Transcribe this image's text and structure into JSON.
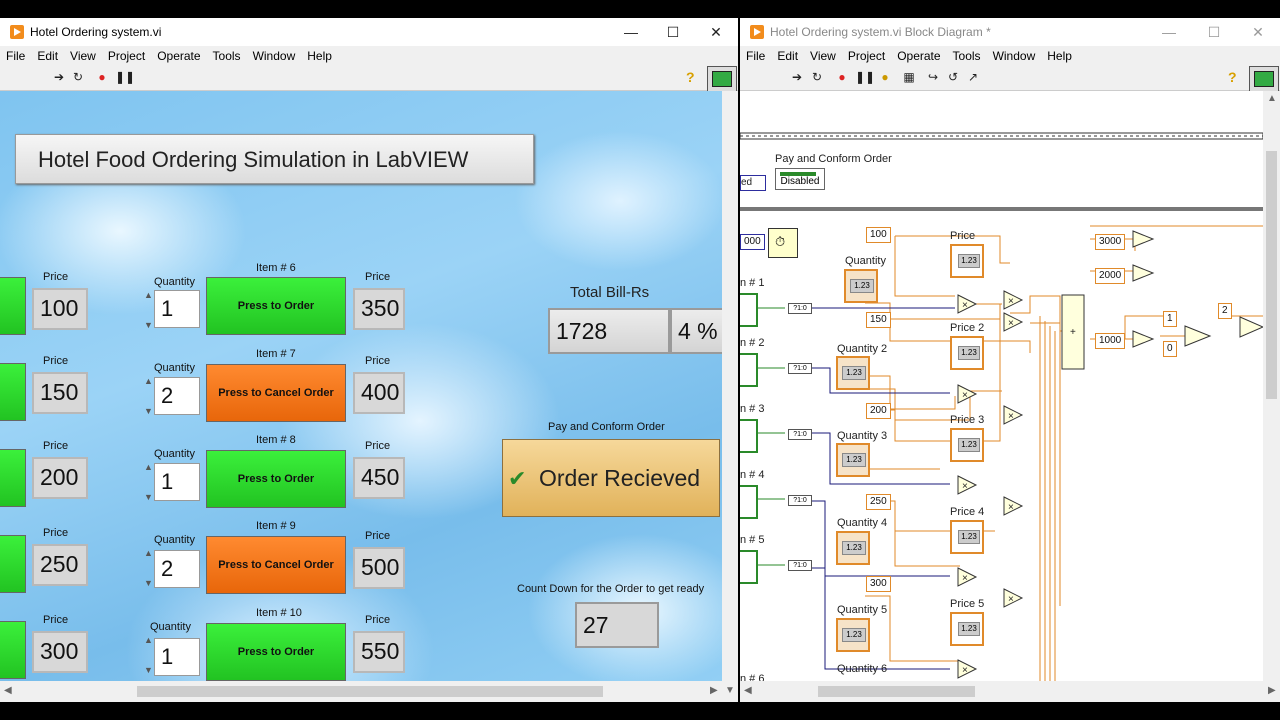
{
  "front": {
    "title": "Hotel Ordering system.vi",
    "menu": [
      "File",
      "Edit",
      "View",
      "Project",
      "Operate",
      "Tools",
      "Window",
      "Help"
    ],
    "banner": "Hotel Food Ordering Simulation in LabVIEW",
    "price_label": "Price",
    "quantity_label": "Quantity",
    "left_prices": [
      "100",
      "150",
      "200",
      "250",
      "300"
    ],
    "items": [
      {
        "label": "Item # 6",
        "qty": "1",
        "button": "Press to Order",
        "state": "order",
        "price": "350"
      },
      {
        "label": "Item # 7",
        "qty": "2",
        "button": "Press to Cancel Order",
        "state": "cancel",
        "price": "400"
      },
      {
        "label": "Item # 8",
        "qty": "1",
        "button": "Press to Order",
        "state": "order",
        "price": "450"
      },
      {
        "label": "Item # 9",
        "qty": "2",
        "button": "Press to Cancel Order",
        "state": "cancel",
        "price": "500"
      },
      {
        "label": "Item # 10",
        "qty": "1",
        "button": "Press to Order",
        "state": "order",
        "price": "550"
      }
    ],
    "total_label": "Total Bill-Rs",
    "total_value": "1728",
    "discount": "4 %",
    "pay_label": "Pay and Conform Order",
    "pay_button": "Order Recieved",
    "countdown_label": "Count Down for the Order to get ready",
    "countdown_value": "27"
  },
  "block": {
    "title": "Hotel Ordering system.vi Block Diagram *",
    "menu": [
      "File",
      "Edit",
      "View",
      "Project",
      "Operate",
      "Tools",
      "Window",
      "Help"
    ],
    "pay_label": "Pay and Conform Order",
    "disabled": "Disabled",
    "enum_text": "ed",
    "timer_const": "000",
    "item_labels": [
      "n # 1",
      "n # 2",
      "n # 3",
      "n # 4",
      "n # 5",
      "n # 6"
    ],
    "price_consts": [
      "100",
      "150",
      "200",
      "250",
      "300"
    ],
    "price_labels": [
      "Price",
      "Price 2",
      "Price 3",
      "Price 4",
      "Price 5"
    ],
    "quantity_labels": [
      "Quantity",
      "Quantity 2",
      "Quantity 3",
      "Quantity 4",
      "Quantity 5",
      "Quantity 6"
    ],
    "threshold_consts": [
      "3000",
      "2000",
      "1000"
    ],
    "select_consts": [
      "1",
      "0",
      "2"
    ]
  }
}
